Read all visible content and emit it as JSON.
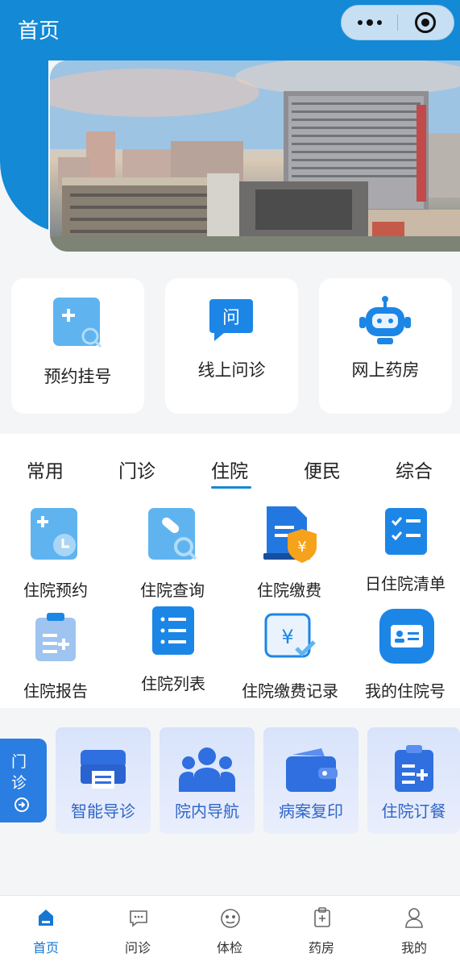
{
  "header": {
    "title": "首页",
    "more_icon": "more-dots-icon",
    "close_icon": "target-circle-icon",
    "accent": "#1489d6"
  },
  "quick_entries": [
    {
      "label": "预约挂号",
      "icon": "register-plus-icon"
    },
    {
      "label": "线上问诊",
      "icon": "consult-chat-icon"
    },
    {
      "label": "网上药房",
      "icon": "robot-icon"
    }
  ],
  "tabs": {
    "items": [
      "常用",
      "门诊",
      "住院",
      "便民",
      "综合"
    ],
    "active": "住院"
  },
  "grid": [
    {
      "label": "住院预约",
      "icon": "appointment-clock-icon"
    },
    {
      "label": "住院查询",
      "icon": "search-pill-icon"
    },
    {
      "label": "住院缴费",
      "icon": "payment-doc-icon"
    },
    {
      "label": "日住院清单",
      "icon": "checklist-icon"
    },
    {
      "label": "住院报告",
      "icon": "clipboard-report-icon"
    },
    {
      "label": "住院列表",
      "icon": "list-icon"
    },
    {
      "label": "住院缴费记录",
      "icon": "yuan-check-icon"
    },
    {
      "label": "我的住院号",
      "icon": "id-card-icon"
    }
  ],
  "services": {
    "tag": [
      "门",
      "诊"
    ],
    "items": [
      {
        "label": "智能导诊",
        "icon": "printer-icon"
      },
      {
        "label": "院内导航",
        "icon": "people-icon"
      },
      {
        "label": "病案复印",
        "icon": "wallet-icon"
      },
      {
        "label": "住院订餐",
        "icon": "clipboard-plus-icon"
      }
    ]
  },
  "bottom_nav": [
    {
      "label": "首页",
      "icon": "home-icon",
      "active": true
    },
    {
      "label": "问诊",
      "icon": "chat-icon",
      "active": false
    },
    {
      "label": "体检",
      "icon": "checkup-icon",
      "active": false
    },
    {
      "label": "药房",
      "icon": "pharmacy-icon",
      "active": false
    },
    {
      "label": "我的",
      "icon": "user-icon",
      "active": false
    }
  ]
}
